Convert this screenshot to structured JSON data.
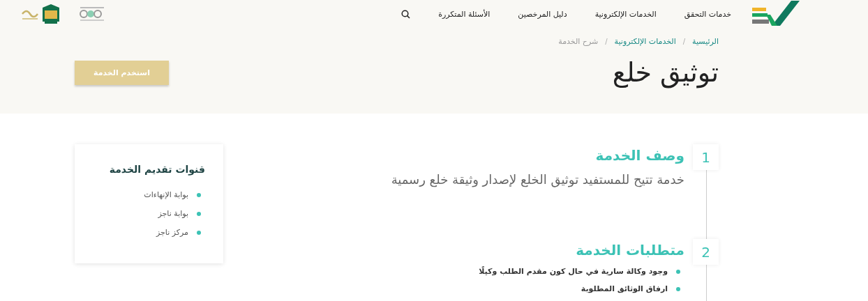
{
  "nav": {
    "items": [
      {
        "label": "خدمات التحقق"
      },
      {
        "label": "الخدمات الإلكترونية"
      },
      {
        "label": "دليل المرخصين"
      },
      {
        "label": "الأسئلة المتكررة"
      }
    ]
  },
  "breadcrumb": [
    {
      "label": "الرئيسية",
      "current": false
    },
    {
      "label": "الخدمات الإلكترونية",
      "current": false
    },
    {
      "label": "شرح الخدمة",
      "current": true
    }
  ],
  "separator": "/",
  "title": "توثيق خلع",
  "use_button": "استخدم الخدمة",
  "steps": [
    {
      "number": "1",
      "heading": "وصف الخدمة",
      "kind": "text",
      "text": "خدمة تتيح للمستفيد توثيق الخلع لإصدار وثيقة خلع رسمية"
    },
    {
      "number": "2",
      "heading": "متطلبات الخدمة",
      "kind": "list",
      "items": [
        "وجود وكالة سارية في حال كون مقدم الطلب وكيلًا",
        "ارفاق الوثائق المطلوبة"
      ]
    }
  ],
  "channels": {
    "title": "قنوات تقديم الخدمة",
    "items": [
      "بوابة الإنهاءات",
      "بوابة ناجز",
      "مركز ناجز"
    ]
  }
}
